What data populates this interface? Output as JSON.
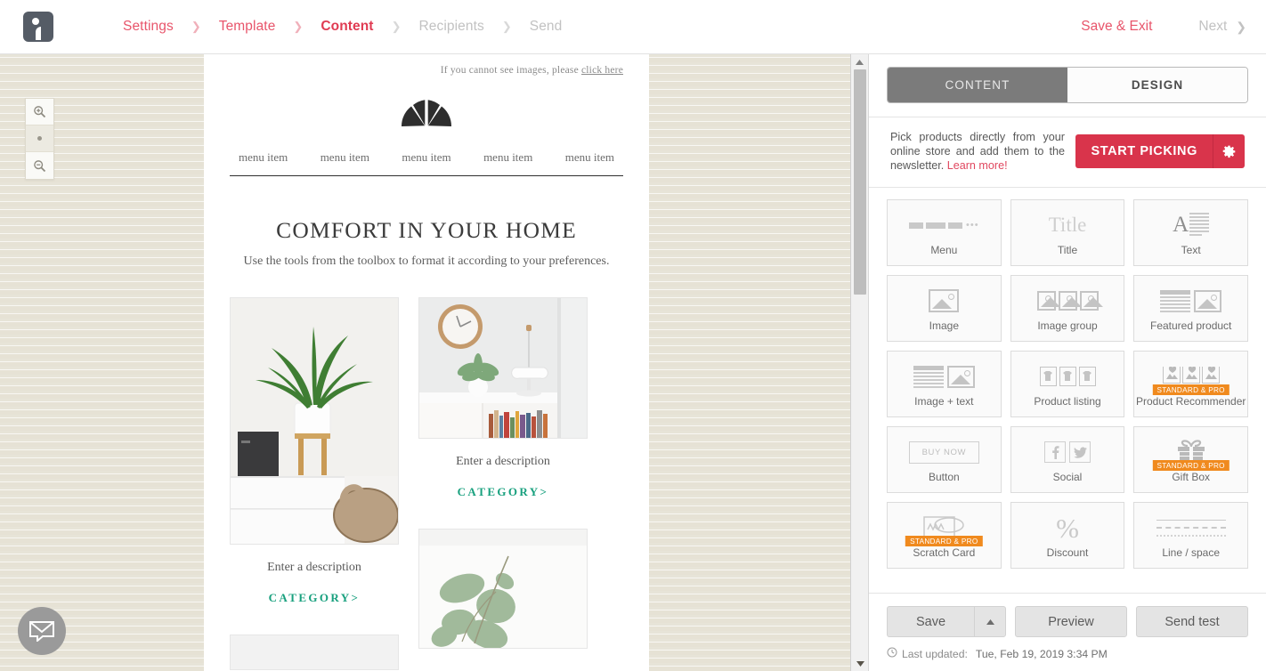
{
  "topbar": {
    "logo_icon": "brand-logo-icon",
    "breadcrumb": [
      {
        "label": "Settings",
        "state": "done"
      },
      {
        "label": "Template",
        "state": "done"
      },
      {
        "label": "Content",
        "state": "active"
      },
      {
        "label": "Recipients",
        "state": "disabled"
      },
      {
        "label": "Send",
        "state": "disabled"
      }
    ],
    "save_exit_label": "Save & Exit",
    "next_label": "Next",
    "next_chevron": "chevron-right-icon"
  },
  "stage": {
    "zoom_in_icon": "zoom-in-icon",
    "zoom_reset_icon": "zoom-reset-dot-icon",
    "zoom_out_icon": "zoom-out-icon",
    "chat_icon": "envelope-chat-icon",
    "scrollbar": {
      "up_icon": "scroll-up-arrow-icon",
      "down_icon": "scroll-down-arrow-icon"
    }
  },
  "email": {
    "preheader_text": "If you cannot see images, please ",
    "preheader_link": "click here",
    "logo_icon": "fan-logo-icon",
    "menu_items": [
      "menu item",
      "menu item",
      "menu item",
      "menu item",
      "menu item"
    ],
    "headline": "COMFORT IN YOUR HOME",
    "subhead": "Use the tools from the toolbox to format it according to your preferences.",
    "cards": [
      {
        "description": "Enter a description",
        "category": "CATEGORY>"
      },
      {
        "description": "Enter a description",
        "category": "CATEGORY>"
      }
    ]
  },
  "panel": {
    "tabs": [
      {
        "label": "CONTENT",
        "active": true
      },
      {
        "label": "DESIGN",
        "active": false
      }
    ],
    "picker": {
      "text": "Pick products directly from your online store and add them to the newsletter. ",
      "link": "Learn more!",
      "button_label": "START PICKING",
      "gear_icon": "gear-icon"
    },
    "blocks": [
      [
        {
          "label": "Menu",
          "icon": "menu-blocks-icon",
          "badge": null
        },
        {
          "label": "Title",
          "icon": "title-icon",
          "badge": null
        },
        {
          "label": "Text",
          "icon": "text-icon",
          "badge": null
        }
      ],
      [
        {
          "label": "Image",
          "icon": "image-icon",
          "badge": null
        },
        {
          "label": "Image group",
          "icon": "image-group-icon",
          "badge": null
        },
        {
          "label": "Featured product",
          "icon": "featured-product-icon",
          "badge": null
        }
      ],
      [
        {
          "label": "Image + text",
          "icon": "image-text-icon",
          "badge": null
        },
        {
          "label": "Product listing",
          "icon": "product-listing-icon",
          "badge": null
        },
        {
          "label": "Product Recommender",
          "icon": "product-recommender-icon",
          "badge": "STANDARD & PRO"
        }
      ],
      [
        {
          "label": "Button",
          "icon": "button-icon",
          "badge": null,
          "inner_label": "BUY NOW"
        },
        {
          "label": "Social",
          "icon": "social-icon",
          "badge": null
        },
        {
          "label": "Gift Box",
          "icon": "gift-box-icon",
          "badge": "STANDARD & PRO"
        }
      ],
      [
        {
          "label": "Scratch Card",
          "icon": "scratch-card-icon",
          "badge": "STANDARD & PRO"
        },
        {
          "label": "Discount",
          "icon": "percent-icon",
          "badge": null
        },
        {
          "label": "Line / space",
          "icon": "line-space-icon",
          "badge": null
        }
      ]
    ],
    "footer": {
      "save_label": "Save",
      "save_caret_icon": "caret-up-icon",
      "preview_label": "Preview",
      "send_test_label": "Send test",
      "clock_icon": "clock-icon",
      "last_updated_label": "Last updated:",
      "last_updated_value": "Tue, Feb 19, 2019 3:34 PM"
    }
  },
  "colors": {
    "accent_red": "#e0475f",
    "button_red": "#d9344b",
    "badge_orange": "#f08a1e",
    "category_green": "#18a07e",
    "tab_active_gray": "#7b7b7b"
  }
}
